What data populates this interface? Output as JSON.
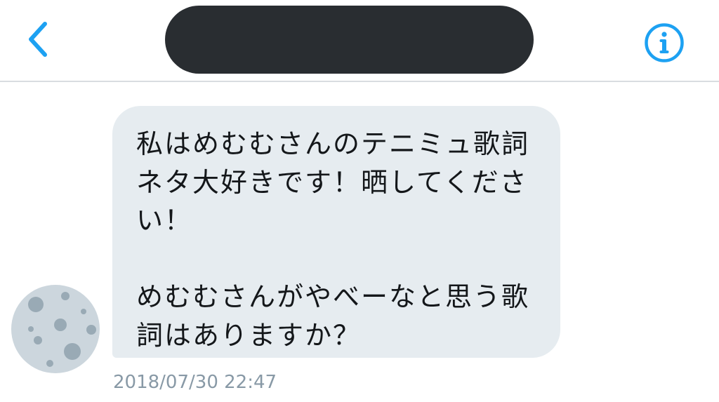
{
  "header": {
    "title": "",
    "accent_color": "#1da1f2",
    "back_icon": "chevron-left-icon",
    "info_icon": "info-icon"
  },
  "conversation": {
    "messages": [
      {
        "lines": [
          "私はめむむさんのテニミュ歌詞",
          "ネタ大好きです！晒してくださ",
          "い！",
          "",
          "めむむさんがやべーなと思う歌",
          "詞はありますか？"
        ],
        "timestamp": "2018/07/30 22:47",
        "avatar": "moon-avatar",
        "bubble_color": "#e6ecf0"
      }
    ]
  }
}
